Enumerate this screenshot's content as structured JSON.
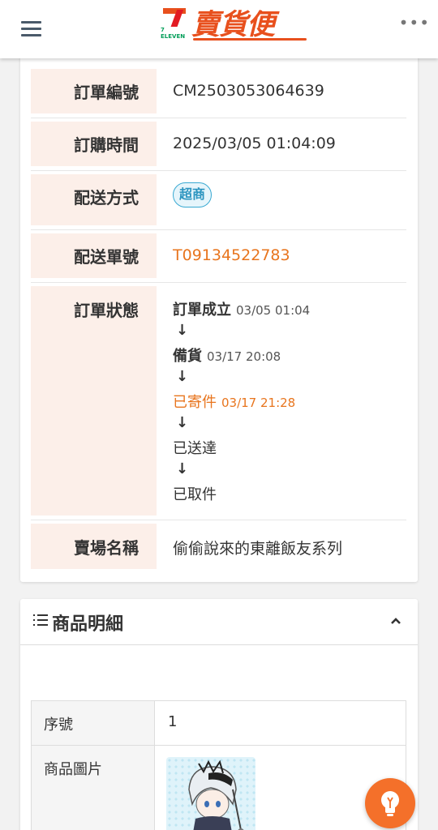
{
  "header": {
    "logo_brand": "7 ELEVEN",
    "logo_text": "賣貨便",
    "more_label": "•••"
  },
  "order": {
    "rows": [
      {
        "label": "訂單編號",
        "value": "CM2503053064639"
      },
      {
        "label": "訂購時間",
        "value": "2025/03/05 01:04:09"
      },
      {
        "label": "配送方式",
        "badge": "超商"
      },
      {
        "label": "配送單號",
        "value": "T09134522783"
      },
      {
        "label": "訂單狀態"
      },
      {
        "label": "賣場名稱",
        "value": "偷偷說來的東離飯友系列"
      }
    ],
    "status_steps": [
      {
        "name": "訂單成立",
        "time": "03/05 01:04"
      },
      {
        "name": "備貨",
        "time": "03/17 20:08"
      },
      {
        "name": "已寄件",
        "time": "03/17 21:28"
      },
      {
        "name": "已送達",
        "time": ""
      },
      {
        "name": "已取件",
        "time": ""
      }
    ],
    "arrow": "↓"
  },
  "products": {
    "title": "商品明細",
    "chevron": "^",
    "table": [
      {
        "label": "序號",
        "value": "1"
      },
      {
        "label": "商品圖片"
      }
    ]
  },
  "colors": {
    "brand_orange": "#e8501d",
    "status_orange": "#e8751e",
    "label_bg": "#fcefe9",
    "badge_blue": "#39a9d2",
    "fab": "#f4702a"
  },
  "icons": {
    "menu": "menu-icon",
    "more": "more-dots-icon",
    "list": "list-icon",
    "collapse": "chevron-up-icon",
    "fab": "lightbulb-icon"
  }
}
